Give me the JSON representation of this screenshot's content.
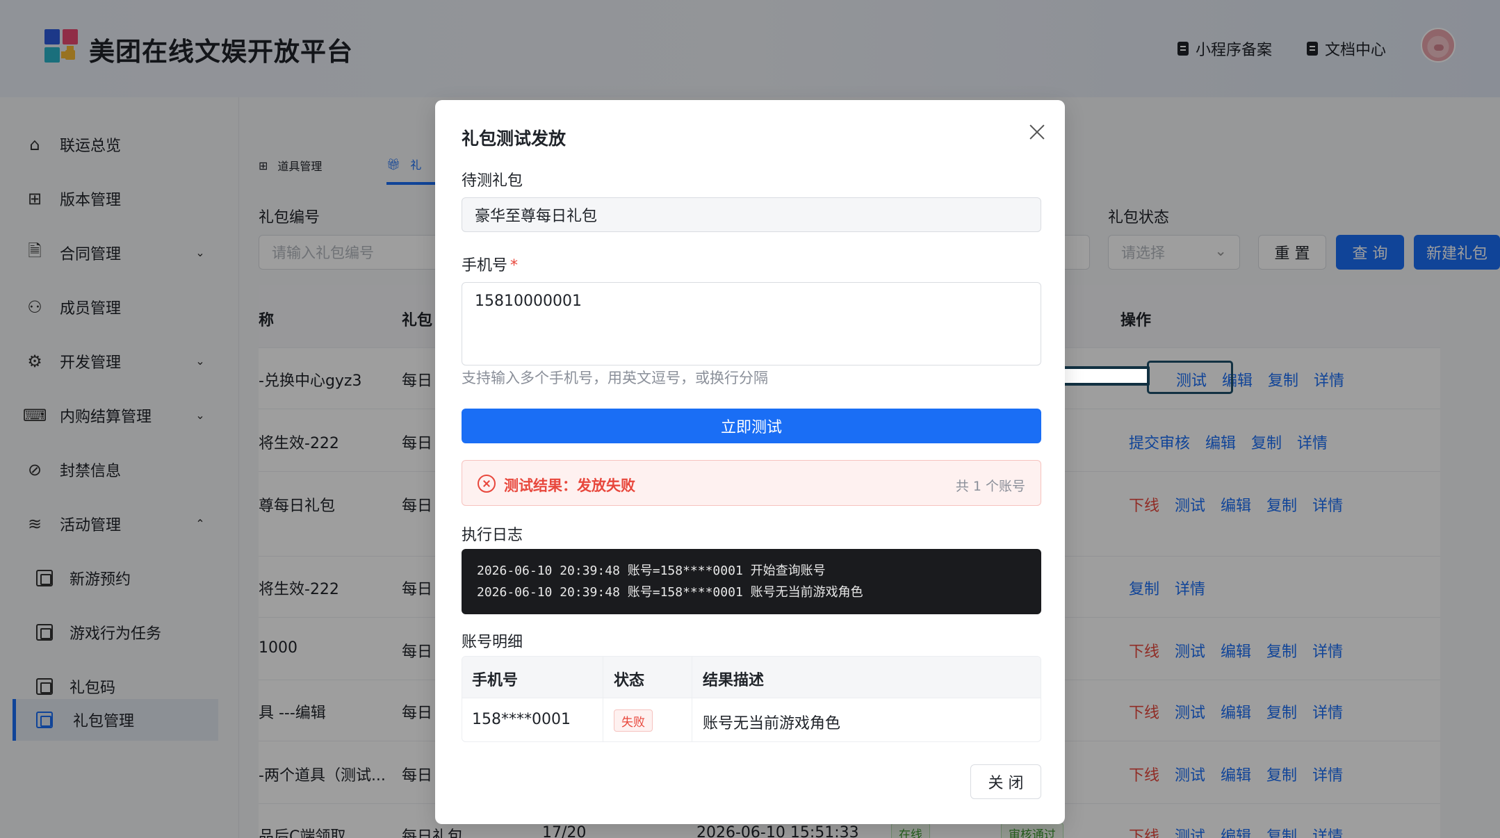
{
  "header": {
    "brand": "美团在线文娱开放平台",
    "links": [
      "小程序备案",
      "文档中心"
    ],
    "logo_colors": [
      "#2e5bdc",
      "#e84a72",
      "#2bb4c9",
      "#f5b935"
    ]
  },
  "sidebar": {
    "items": [
      {
        "label": "联运总览",
        "icon": "home-icon"
      },
      {
        "label": "版本管理",
        "icon": "grid-icon"
      },
      {
        "label": "合同管理",
        "icon": "document-icon"
      },
      {
        "label": "成员管理",
        "icon": "users-icon"
      },
      {
        "label": "开发管理",
        "icon": "gear-icon"
      },
      {
        "label": "内购结算管理",
        "icon": "keyboard-icon"
      },
      {
        "label": "封禁信息",
        "icon": "ban-icon"
      },
      {
        "label": "活动管理",
        "icon": "layers-icon"
      },
      {
        "label": "新游预约",
        "icon": "frame-icon"
      },
      {
        "label": "游戏行为任务",
        "icon": "frame-icon"
      },
      {
        "label": "礼包码",
        "icon": "frame-icon"
      },
      {
        "label": "礼包管理",
        "icon": "frame-icon"
      }
    ]
  },
  "tabs": [
    "道具管理",
    "礼"
  ],
  "filters": {
    "code_label": "礼包编号",
    "code_placeholder": "请输入礼包编号",
    "status_label": "礼包状态",
    "status_placeholder": "请选择",
    "reset": "重 置",
    "query": "查 询",
    "create": "新建礼包"
  },
  "table": {
    "headers": [
      "称",
      "礼包",
      "操作"
    ],
    "rows": [
      {
        "name": "-兑换中心gyz3",
        "type": "每日"
      },
      {
        "name": "将生效-222",
        "type": "每日"
      },
      {
        "name": "尊每日礼包",
        "type": "每日"
      },
      {
        "name": "将生效-222",
        "type": "每日"
      },
      {
        "name": "1000",
        "type": "每日"
      },
      {
        "name": "具 ---编辑",
        "type": "每日"
      },
      {
        "name": "-两个道具（测试...",
        "type": "每日"
      },
      {
        "name": "品后C端领取",
        "type": "每日礼包",
        "count": "17/20",
        "time": "2026-06-10 15:51:33",
        "online": "在线",
        "audit": "审核通过"
      }
    ],
    "actions": {
      "offline": "下线",
      "test": "测试",
      "edit": "编辑",
      "copy": "复制",
      "detail": "详情",
      "submit": "提交审核"
    }
  },
  "modal": {
    "title": "礼包测试发放",
    "package_label": "待测礼包",
    "package_value": "豪华至尊每日礼包",
    "phone_label": "手机号",
    "phone_required": "*",
    "phone_value": "15810000001",
    "hint": "支持输入多个手机号，用英文逗号，或换行分隔",
    "run_button": "立即测试",
    "result_text": "测试结果：发放失败",
    "result_count": "共 1 个账号",
    "log_label": "执行日志",
    "log_lines": [
      "2026-06-10 20:39:48 账号=158****0001 开始查询账号",
      "2026-06-10 20:39:48 账号=158****0001 账号无当前游戏角色"
    ],
    "detail_label": "账号明细",
    "detail_headers": [
      "手机号",
      "状态",
      "结果描述"
    ],
    "detail_row": {
      "phone": "158****0001",
      "status": "失败",
      "desc": "账号无当前游戏角色"
    },
    "close_button": "关 闭"
  },
  "colors": {
    "primary": "#1a6ef5",
    "danger": "#e8473c",
    "annotation": "#123142"
  }
}
